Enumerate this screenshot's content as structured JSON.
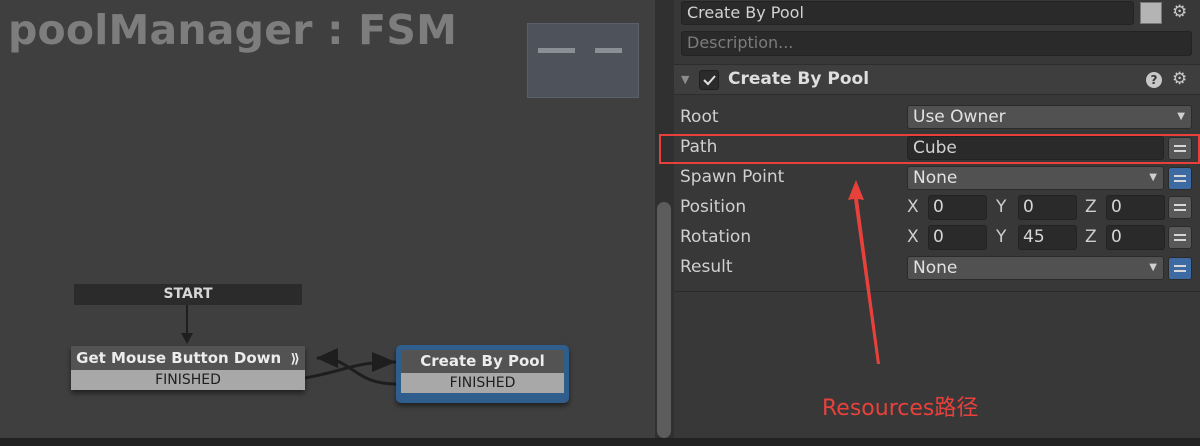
{
  "graph": {
    "title": "poolManager : FSM",
    "start_label": "START",
    "states": [
      {
        "name": "Get Mouse Button Down",
        "event": "FINISHED",
        "badge": "⟫"
      },
      {
        "name": "Create By Pool",
        "event": "FINISHED"
      }
    ]
  },
  "inspector": {
    "state_name": "Create By Pool",
    "description_placeholder": "Description...",
    "action": {
      "title": "Create By Pool",
      "enabled": true,
      "fields": {
        "root": {
          "label": "Root",
          "value": "Use Owner"
        },
        "path": {
          "label": "Path",
          "value": "Cube"
        },
        "spawn_point": {
          "label": "Spawn Point",
          "value": "None"
        },
        "position": {
          "label": "Position",
          "x": "0",
          "y": "0",
          "z": "0"
        },
        "rotation": {
          "label": "Rotation",
          "x": "0",
          "y": "45",
          "z": "0"
        },
        "result": {
          "label": "Result",
          "value": "None"
        }
      },
      "axis": {
        "x": "X",
        "y": "Y",
        "z": "Z"
      }
    },
    "icons": [
      "help-icon",
      "gear-icon",
      "checkmark-icon",
      "dropdown-arrow-icon",
      "variable-toggle-icon"
    ]
  },
  "annotation": {
    "text": "Resources路径",
    "color": "#e8413c"
  },
  "colors": {
    "selected_state": "#2f5d8c",
    "variable_toggle_active": "#3e6aa3",
    "annotation": "#e8413c"
  }
}
